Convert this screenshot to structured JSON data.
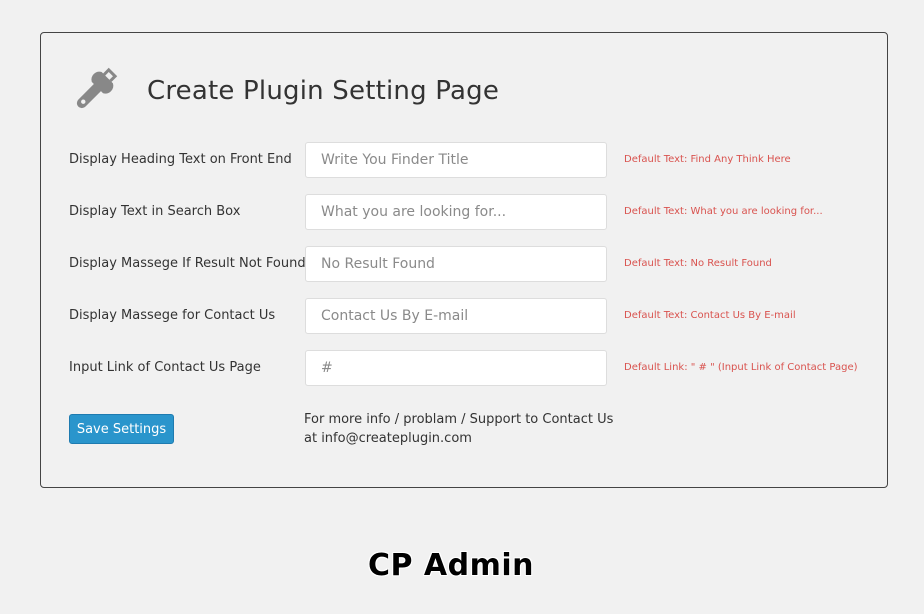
{
  "page": {
    "title": "Create Plugin Setting Page",
    "header_icon": "wrench-icon"
  },
  "settings": [
    {
      "label": "Display Heading Text on Front End",
      "placeholder": "Write You Finder Title",
      "value": "",
      "hint": "Default Text: Find Any Think Here"
    },
    {
      "label": "Display Text in Search Box",
      "placeholder": "What you are looking for...",
      "value": "",
      "hint": "Default Text: What you are looking for..."
    },
    {
      "label": "Display Massege If Result Not Found",
      "placeholder": "No Result Found",
      "value": "",
      "hint": "Default Text: No Result Found"
    },
    {
      "label": "Display Massege for Contact Us",
      "placeholder": "Contact Us By E-mail",
      "value": "",
      "hint": "Default Text: Contact Us By E-mail"
    },
    {
      "label": "Input Link of Contact Us Page",
      "placeholder": "#",
      "value": "",
      "hint": "Default Link: \" # \" (Input Link of Contact Page)"
    }
  ],
  "actions": {
    "save_label": "Save Settings"
  },
  "support": {
    "text": "For more info / problam / Support to Contact Us at info@createplugin.com"
  },
  "footer": {
    "brand": "CP Admin"
  },
  "colors": {
    "background": "#f1f1f1",
    "accent": "#2a95cc",
    "hint": "#d9534f"
  }
}
